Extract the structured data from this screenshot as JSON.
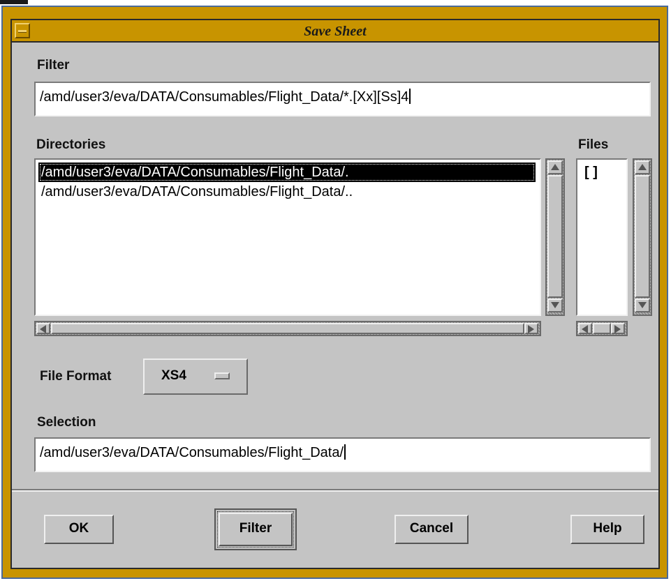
{
  "window": {
    "title": "Save Sheet"
  },
  "filter": {
    "label": "Filter",
    "value": "/amd/user3/eva/DATA/Consumables/Flight_Data/*.[Xx][Ss]4"
  },
  "directories": {
    "label": "Directories",
    "items": [
      "/amd/user3/eva/DATA/Consumables/Flight_Data/.",
      "/amd/user3/eva/DATA/Consumables/Flight_Data/.."
    ],
    "selected_index": 0
  },
  "files": {
    "label": "Files",
    "items": [
      "[   ]"
    ]
  },
  "file_format": {
    "label": "File Format",
    "value": "XS4"
  },
  "selection": {
    "label": "Selection",
    "value": "/amd/user3/eva/DATA/Consumables/Flight_Data/"
  },
  "buttons": {
    "ok": "OK",
    "filter": "Filter",
    "cancel": "Cancel",
    "help": "Help"
  },
  "colors": {
    "frame": "#c89400",
    "client": "#c4c4c4",
    "selection_bg": "#000000"
  }
}
